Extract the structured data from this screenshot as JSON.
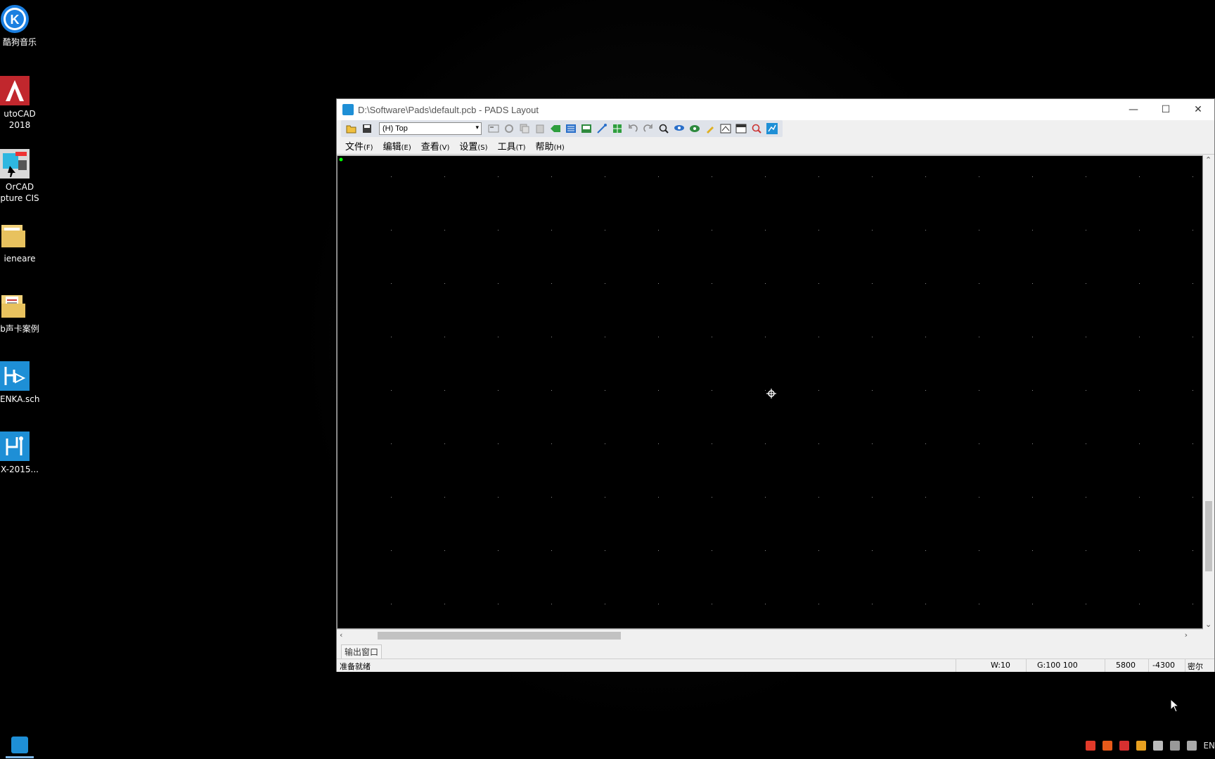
{
  "desktop": {
    "icons": [
      {
        "label": "酷狗音乐",
        "icon": "kugou-music-icon"
      },
      {
        "label": "utoCAD",
        "label2": "2018",
        "icon": "autocad-icon"
      },
      {
        "label": "OrCAD",
        "label2": "pture CIS",
        "icon": "orcad-icon"
      },
      {
        "label": "ieneare",
        "icon": "folder-icon"
      },
      {
        "label": "b声卡案例",
        "icon": "folder-docs-icon"
      },
      {
        "label": "ENKA.sch",
        "icon": "pads-logic-file-icon"
      },
      {
        "label": "X-2015...",
        "icon": "pads-app-icon"
      }
    ]
  },
  "window": {
    "title": "D:\\Software\\Pads\\default.pcb - PADS Layout",
    "controls": {
      "minimize": "—",
      "maximize": "☐",
      "close": "✕"
    }
  },
  "toolbar": {
    "layer": "(H) Top",
    "layer_arrow": "▾"
  },
  "menu": [
    {
      "label": "文件",
      "accel": "(F)"
    },
    {
      "label": "编辑",
      "accel": "(E)"
    },
    {
      "label": "查看",
      "accel": "(V)"
    },
    {
      "label": "设置",
      "accel": "(S)"
    },
    {
      "label": "工具",
      "accel": "(T)"
    },
    {
      "label": "帮助",
      "accel": "(H)"
    }
  ],
  "output_tab": "输出窗口",
  "status": {
    "ready": "准备就绪",
    "width": "W:10",
    "grid": "G:100 100",
    "x": "5800",
    "y": "-4300",
    "units": "密尔"
  },
  "tray": {
    "lang": "EN"
  },
  "colors": {
    "canvas": "#000000",
    "grid_dot": "#8c8c8c",
    "origin": "#00ff00",
    "accent": "#1e8fd6"
  }
}
